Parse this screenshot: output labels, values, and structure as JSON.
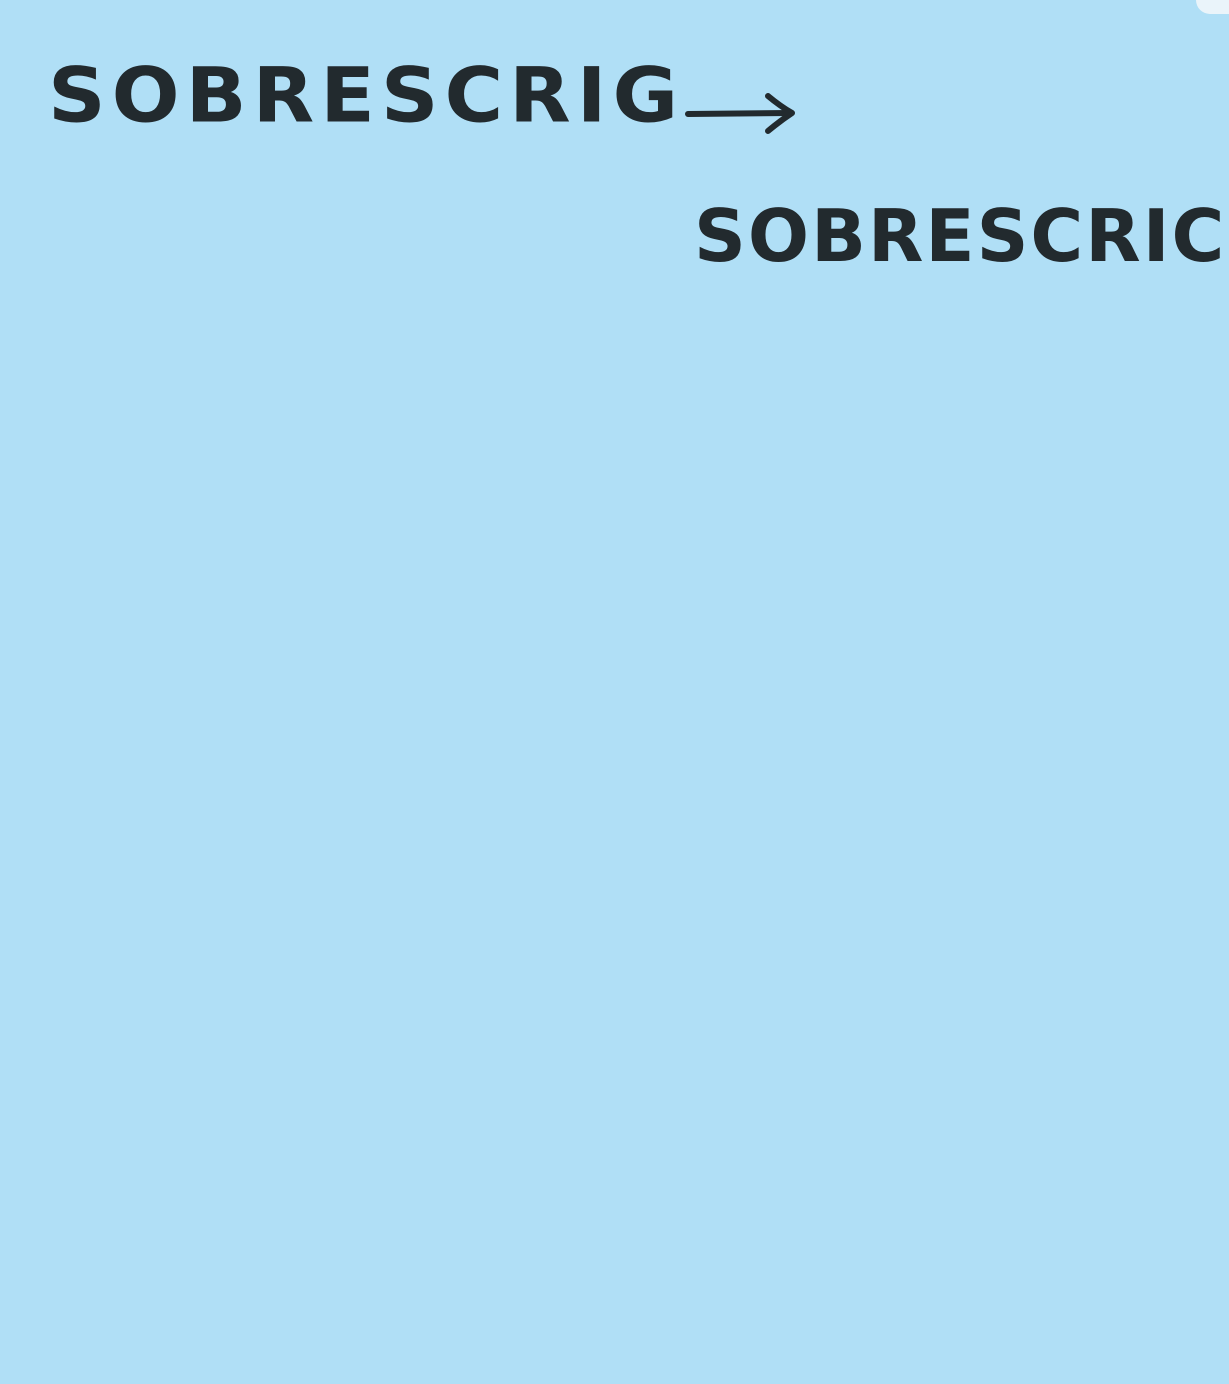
{
  "note": {
    "background_color": "#b0dff6",
    "ink_color": "#222a2e",
    "first_word": "SOBRESCRIG",
    "second_word": "SOBRESCRICH",
    "arrow_icon": "right-arrow-icon"
  }
}
